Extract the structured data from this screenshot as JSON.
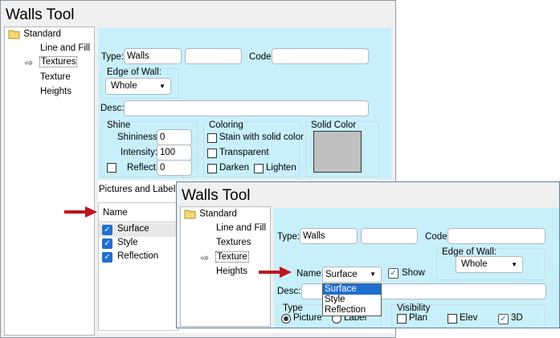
{
  "back": {
    "title": "Walls Tool",
    "tree": {
      "root": "Standard",
      "items": [
        "Line and Fill",
        "Textures",
        "Texture",
        "Heights"
      ]
    },
    "form": {
      "type_label": "Type:",
      "type_value": "Walls",
      "type_value2": "",
      "code_label": "Code:",
      "code_value": "",
      "edge_label": "Edge of Wall:",
      "edge_value": "Whole",
      "desc_label": "Desc:",
      "desc_value": "",
      "shine": {
        "label": "Shine",
        "shininess_label": "Shininess:",
        "shininess_value": "0",
        "intensity_label": "Intensity:",
        "intensity_value": "100",
        "reflect_label": "Reflect:",
        "reflect_value": "0"
      },
      "coloring": {
        "label": "Coloring",
        "stain_label": "Stain with solid color",
        "transparent_label": "Transparent",
        "darken_label": "Darken",
        "lighten_label": "Lighten"
      },
      "solid_color_label": "Solid Color",
      "solid_color": "#c0c0c0"
    },
    "pictures": {
      "header": "Pictures and Labels",
      "column": "Name",
      "rows": [
        "Surface",
        "Style",
        "Reflection"
      ]
    }
  },
  "front": {
    "title": "Walls Tool",
    "tree": {
      "root": "Standard",
      "items": [
        "Line and Fill",
        "Textures",
        "Texture",
        "Heights"
      ]
    },
    "form": {
      "type_label": "Type:",
      "type_value": "Walls",
      "type_value2": "",
      "code_label": "Code:",
      "code_value": "",
      "edge_label": "Edge of Wall:",
      "edge_value": "Whole",
      "name_label": "Name:",
      "name_value": "Surface",
      "name_options": [
        "Surface",
        "Style",
        "Reflection"
      ],
      "show_label": "Show",
      "desc_label": "Desc:",
      "type_group_label": "Type",
      "picture_label": "Picture",
      "label_label": "Label",
      "visibility_label": "Visibility",
      "plan_label": "Plan",
      "elev_label": "Elev",
      "three_d_label": "3D"
    }
  },
  "colors": {
    "panel": "#c8f0fb",
    "accent": "#1f6fd0",
    "arrow": "#c0141c",
    "dropdown_highlight": "#1f6fd0"
  }
}
